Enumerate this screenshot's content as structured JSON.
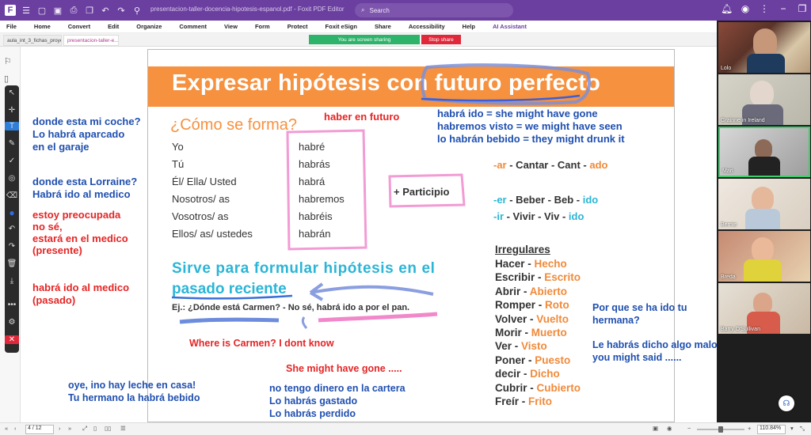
{
  "titlebar": {
    "doc_title": "presentacion-taller-docencia-hipotesis-espanol.pdf - Foxit PDF Editor",
    "search_placeholder": "Search"
  },
  "menu": [
    "File",
    "Home",
    "Convert",
    "Edit",
    "Organize",
    "Comment",
    "View",
    "Form",
    "Protect",
    "Foxit eSign",
    "Share",
    "Accessibility",
    "Help",
    "AI Assistant"
  ],
  "tabs": [
    "aula_int_3_fichas_proye...",
    "presentacion-taller-e..."
  ],
  "sharing": {
    "status": "You are screen sharing",
    "stop": "Stop share"
  },
  "slide": {
    "title": "Expresar hipótesis con futuro perfecto",
    "como": "¿Cómo se forma?",
    "pronouns": [
      "Yo",
      "Tú",
      "Él/ Ella/ Usted",
      "Nosotros/ as",
      "Vosotros/ as",
      "Ellos/ as/ ustedes"
    ],
    "haber": [
      "habré",
      "habrás",
      "habrá",
      "habremos",
      "habréis",
      "habrán"
    ],
    "participio": "+ Participio",
    "ar_row": [
      {
        "t": "-ar",
        "c": "orange"
      },
      {
        "t": " - Cantar - Cant - ",
        "c": "dark"
      },
      {
        "t": "ado",
        "c": "orange"
      }
    ],
    "er_row": [
      {
        "t": "-er",
        "c": "cyan"
      },
      {
        "t": " - Beber - Beb - ",
        "c": "dark"
      },
      {
        "t": "ido",
        "c": "cyan"
      }
    ],
    "ir_row": [
      {
        "t": "-ir",
        "c": "cyan"
      },
      {
        "t": " - Vivir - Viv - ",
        "c": "dark"
      },
      {
        "t": "ido",
        "c": "cyan"
      }
    ],
    "irregulares_title": "Irregulares",
    "irregulares": [
      {
        "inf": "Hacer",
        "part": "Hecho"
      },
      {
        "inf": "Escribir",
        "part": "Escrito"
      },
      {
        "inf": "Abrir",
        "part": "Abierto"
      },
      {
        "inf": "Romper",
        "part": "Roto"
      },
      {
        "inf": "Volver",
        "part": "Vuelto"
      },
      {
        "inf": "Morir",
        "part": "Muerto"
      },
      {
        "inf": "Ver",
        "part": "Visto"
      },
      {
        "inf": "Poner",
        "part": "Puesto"
      },
      {
        "inf": "decir",
        "part": "Dicho"
      },
      {
        "inf": "Cubrir",
        "part": "Cubierto"
      },
      {
        "inf": "Freír",
        "part": "Frito"
      }
    ],
    "sirve_line1": "Sirve para formular hipótesis en el",
    "sirve_line2": "pasado reciente",
    "ejemplo": "Ej.: ¿Dónde está Carmen? - No sé, habrá ido a por el pan."
  },
  "annotations": {
    "haber_futuro": "haber en futuro",
    "gloss": [
      "habrá ido = she might have gone",
      "habremos visto = we might have seen",
      "lo habrán bebido = they might drunk it"
    ],
    "where_carmen": "Where is Carmen? I dont know",
    "she_might": "She might have gone .....",
    "left_coche": [
      "donde esta mi coche?",
      "Lo habrá aparcado",
      "en el garaje"
    ],
    "left_lorraine": [
      "donde esta Lorraine?",
      "Habrá ido al medico"
    ],
    "left_preocupada": [
      "estoy preocupada",
      "no sé,",
      "estará en el medico",
      "(presente)"
    ],
    "left_habra_ido": [
      "habrá ido al medico",
      "(pasado)"
    ],
    "leche": [
      "oye, ino hay  leche en casa!",
      "Tu hermano la habrá bebido"
    ],
    "dinero": [
      "no tengo dinero en la cartera",
      "Lo habrás gastado",
      "Lo habrás perdido"
    ],
    "hermana": [
      "Por que se ha ido tu",
      "hermana?"
    ],
    "dicho": [
      "Le habrás dicho algo malo",
      "you might said ......"
    ]
  },
  "status": {
    "page": "4 / 12",
    "zoom": "110.84%",
    "zoom_level": 0.5
  },
  "participants": [
    "Lolo",
    "Grainne in Ireland",
    "Mari",
    "Bernie",
    "Breda",
    "Barry O'Sullivan"
  ]
}
